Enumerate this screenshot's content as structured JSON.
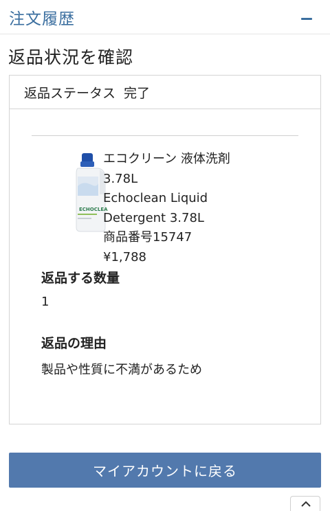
{
  "header": {
    "section_title": "注文履歴"
  },
  "page": {
    "title": "返品状況を確認"
  },
  "return_card": {
    "status_label": "返品ステータス",
    "status_value": "完了",
    "product": {
      "image_icon": "detergent-bottle-image",
      "name_line1": "エコクリーン 液体洗剤",
      "name_line2": "3.78L",
      "name_line3": "Echoclean Liquid",
      "name_line4": "Detergent 3.78L",
      "item_number": "商品番号15747",
      "price": "¥1,788"
    },
    "quantity_label": "返品する数量",
    "quantity_value": "1",
    "reason_label": "返品の理由",
    "reason_value": "製品や性質に不満があるため"
  },
  "actions": {
    "back_to_account": "マイアカウントに戻る"
  },
  "icons": {
    "collapse": "minus-icon",
    "scroll_top": "chevron-up-icon"
  },
  "colors": {
    "accent": "#3a6e9f",
    "button": "#5279ad"
  }
}
